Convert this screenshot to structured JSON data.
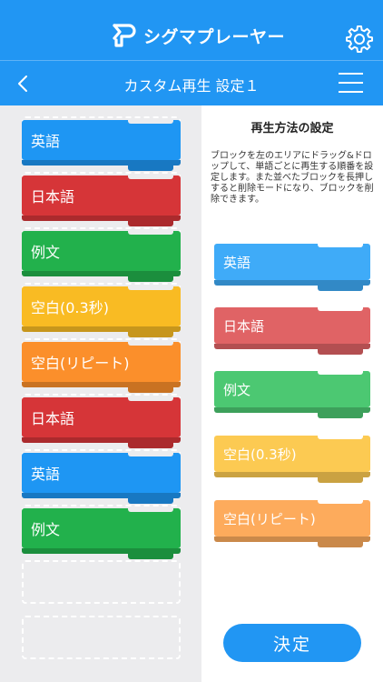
{
  "header": {
    "app_name": "シグマプレーヤー"
  },
  "nav": {
    "title": "カスタム再生 設定１"
  },
  "sequence": [
    {
      "label": "英語",
      "color": "#1e96f3"
    },
    {
      "label": "日本語",
      "color": "#d63538"
    },
    {
      "label": "例文",
      "color": "#22b14c"
    },
    {
      "label": "空白(0.3秒)",
      "color": "#f9bb23"
    },
    {
      "label": "空白(リピート)",
      "color": "#fb8f2b"
    },
    {
      "label": "日本語",
      "color": "#d63538"
    },
    {
      "label": "英語",
      "color": "#1e96f3"
    },
    {
      "label": "例文",
      "color": "#22b14c"
    }
  ],
  "panel": {
    "title": "再生方法の設定",
    "description": "ブロックを左のエリアにドラッグ&ドロップして、単語ごとに再生する順番を設定します。また並べたブロックを長押しすると削除モードになり、ブロックを削除できます。"
  },
  "palette": [
    {
      "label": "英語",
      "color": "#3fabf8"
    },
    {
      "label": "日本語",
      "color": "#e06365"
    },
    {
      "label": "例文",
      "color": "#4cc872"
    },
    {
      "label": "空白(0.3秒)",
      "color": "#fcca52"
    },
    {
      "label": "空白(リピート)",
      "color": "#fdab5c"
    }
  ],
  "confirm_label": "決定"
}
